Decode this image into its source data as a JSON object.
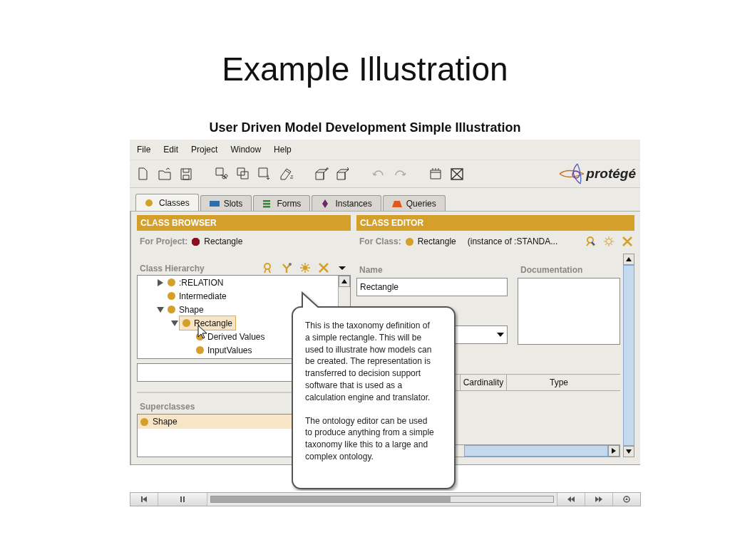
{
  "slide": {
    "title": "Example Illustration",
    "subtitle": "User Driven Model Development Simple Illustration"
  },
  "menu": [
    "File",
    "Edit",
    "Project",
    "Window",
    "Help"
  ],
  "logo": {
    "text": "protégé"
  },
  "tabs": [
    {
      "label": "Classes",
      "selected": true
    },
    {
      "label": "Slots",
      "selected": false
    },
    {
      "label": "Forms",
      "selected": false
    },
    {
      "label": "Instances",
      "selected": false
    },
    {
      "label": "Queries",
      "selected": false
    }
  ],
  "class_browser": {
    "title": "CLASS BROWSER",
    "project_label": "For Project:",
    "project": "Rectangle",
    "hierarchy_label": "Class Hierarchy",
    "tree": [
      {
        "label": ":RELATION",
        "expanded": false,
        "selected": false
      },
      {
        "label": "Intermediate",
        "selected": false
      },
      {
        "label": "Shape",
        "expanded": true,
        "selected": false,
        "children": [
          {
            "label": "Rectangle",
            "expanded": true,
            "selected": true,
            "children": [
              {
                "label": "Derived Values",
                "selected": false
              },
              {
                "label": "InputValues",
                "selected": false
              }
            ]
          }
        ]
      }
    ],
    "superclasses_label": "Superclasses",
    "superclasses": [
      {
        "label": "Shape",
        "selected": true
      }
    ]
  },
  "class_editor": {
    "title": "CLASS EDITOR",
    "class_label": "For Class:",
    "class_name": "Rectangle",
    "instance_of": "(instance of :STANDA...",
    "name_label": "Name",
    "name_value": "Rectangle",
    "documentation_label": "Documentation",
    "table_columns": [
      "Cardinality",
      "Type"
    ]
  },
  "callout": {
    "paragraphs": [
      "This is the taxonomy definition of a simple rectangle. This will be used to illustrate how models can be created. The representation is transferred to decision support software that is used as a calculation engine and translator.",
      "The ontology editor can be used to produce anything from a simple taxonomy like this to a large and complex ontology."
    ]
  }
}
